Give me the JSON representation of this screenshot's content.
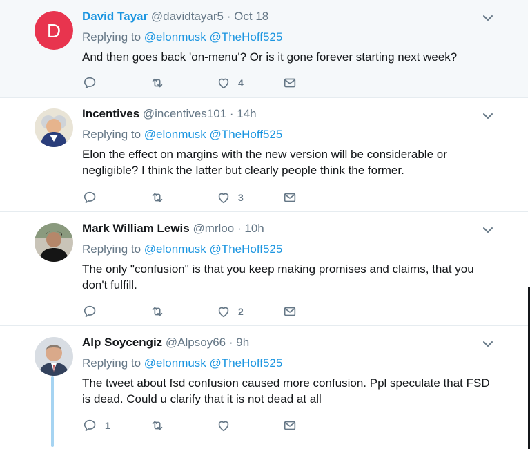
{
  "tweets": [
    {
      "name": "David Tayar",
      "handle": "@davidtayar5",
      "sep": "·",
      "time": "Oct 18",
      "replying_prefix": "Replying to",
      "mentions": [
        "@elonmusk",
        "@TheHoff525"
      ],
      "text": "And then goes back 'on-menu'? Or is it gone forever starting next week?",
      "reply_count": "",
      "retweet_count": "",
      "like_count": "4",
      "avatar_letter": "D",
      "avatar_color": "#e8344e"
    },
    {
      "name": "Incentives",
      "handle": "@incentives101",
      "sep": "·",
      "time": "14h",
      "replying_prefix": "Replying to",
      "mentions": [
        "@elonmusk",
        "@TheHoff525"
      ],
      "text": "Elon the effect on margins with the new version will be considerable or negligible? I think the latter but clearly people think the former.",
      "reply_count": "",
      "retweet_count": "",
      "like_count": "3"
    },
    {
      "name": "Mark William Lewis",
      "handle": "@mrloo",
      "sep": "·",
      "time": "10h",
      "replying_prefix": "Replying to",
      "mentions": [
        "@elonmusk",
        "@TheHoff525"
      ],
      "text": "The only \"confusion\" is that you keep making promises and claims, that you don't fulfill.",
      "reply_count": "",
      "retweet_count": "",
      "like_count": "2"
    },
    {
      "name": "Alp Soycengiz",
      "handle": "@Alpsoy66",
      "sep": "·",
      "time": "9h",
      "replying_prefix": "Replying to",
      "mentions": [
        "@elonmusk",
        "@TheHoff525"
      ],
      "text": "The tweet about fsd confusion caused more confusion. Ppl speculate that FSD is dead. Could u clarify that it is not dead at all",
      "reply_count": "1",
      "retweet_count": "",
      "like_count": ""
    }
  ],
  "colors": {
    "link": "#1b95e0",
    "muted": "#657786",
    "highlight_bg": "#f5f8fa",
    "thread_line": "#a6d4f2"
  },
  "icons": [
    "reply-icon",
    "retweet-icon",
    "like-icon",
    "direct-message-icon",
    "chevron-down-icon"
  ]
}
